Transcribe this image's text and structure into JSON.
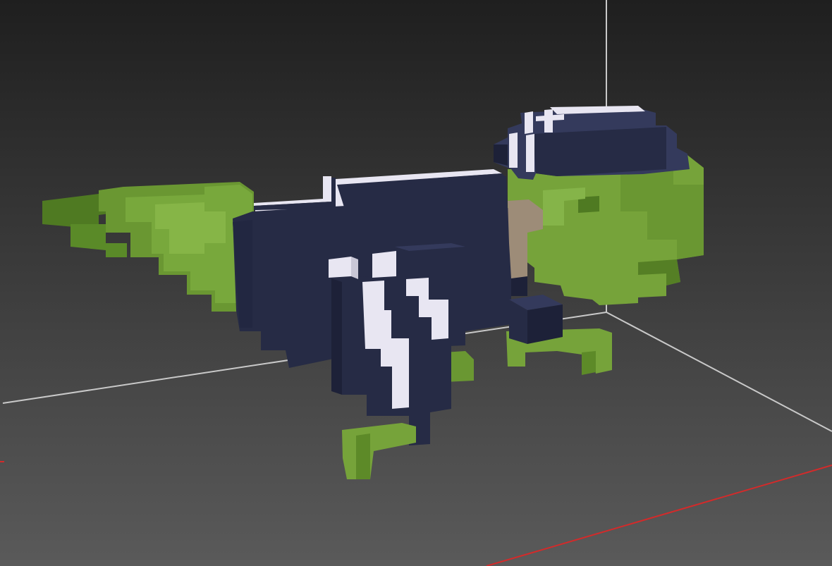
{
  "viewport": {
    "mode": "3d-perspective",
    "background_top": "#1f1f1f",
    "background_bottom": "#5a5a5a",
    "grid_color": "#c9c9c9",
    "x_axis_color": "#d42a2a"
  },
  "model": {
    "name": "voxel-bird",
    "colors": {
      "green_light": "#76a33a",
      "green_mid": "#6a9732",
      "green_dark": "#4f7a22",
      "navy_front": "#262b45",
      "navy_side": "#1d2138",
      "navy_top": "#343a5c",
      "white": "#e8e6f2",
      "beak": "#9d8c78"
    }
  }
}
